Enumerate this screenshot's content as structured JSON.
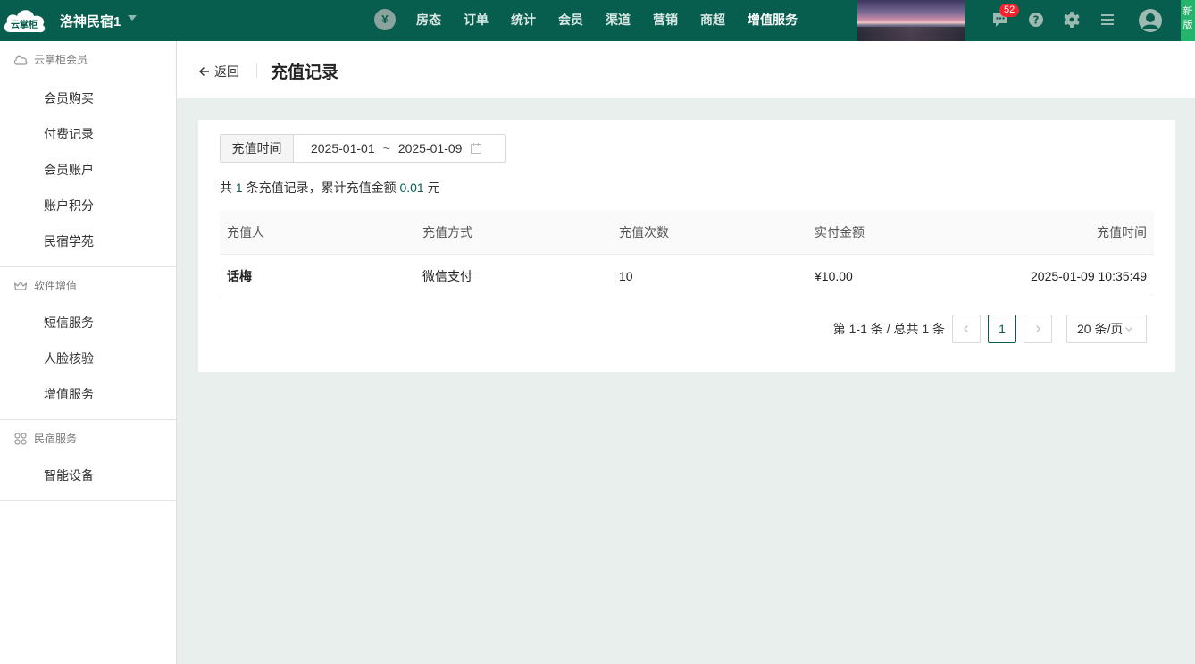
{
  "topbar": {
    "logo_text": "云掌柜",
    "hotel_name": "洛神民宿1",
    "currency_symbol": "¥",
    "nav": [
      "房态",
      "订单",
      "统计",
      "会员",
      "渠道",
      "营销",
      "商超",
      "增值服务"
    ],
    "active_nav": "增值服务",
    "message_count": "52",
    "new_version_label": "新版"
  },
  "sidebar": {
    "groups": [
      {
        "title": "云掌柜会员",
        "icon": "cloud-icon",
        "items": [
          "会员购买",
          "付费记录",
          "会员账户",
          "账户积分",
          "民宿学苑"
        ]
      },
      {
        "title": "软件增值",
        "icon": "crown-icon",
        "items": [
          "短信服务",
          "人脸核验",
          "增值服务"
        ]
      },
      {
        "title": "民宿服务",
        "icon": "grid-icon",
        "items": [
          "智能设备"
        ]
      }
    ]
  },
  "header": {
    "back_label": "返回",
    "title": "充值记录"
  },
  "filter": {
    "label": "充值时间",
    "start_date": "2025-01-01",
    "separator": "~",
    "end_date": "2025-01-09"
  },
  "summary": {
    "prefix": "共",
    "count": "1",
    "middle": "条充值记录，累计充值金额",
    "amount": "0.01",
    "suffix": "元"
  },
  "table": {
    "columns": [
      "充值人",
      "充值方式",
      "充值次数",
      "实付金额",
      "充值时间"
    ],
    "rows": [
      [
        "话梅",
        "微信支付",
        "10",
        "¥10.00",
        "2025-01-09 10:35:49"
      ]
    ]
  },
  "pagination": {
    "total_text": "第 1-1 条 / 总共 1 条",
    "current_page": "1",
    "page_size": "20 条/页"
  },
  "colors": {
    "brand": "#075e4f",
    "accent_new": "#25b46e",
    "badge": "#f5222d"
  }
}
